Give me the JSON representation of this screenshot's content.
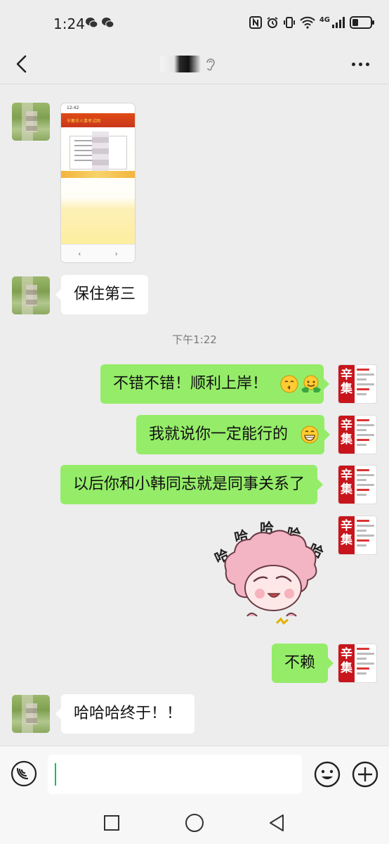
{
  "status_bar": {
    "time": "1:24",
    "network": "4G"
  },
  "nav": {
    "contact_name": ""
  },
  "timestamp": "下午1:22",
  "messages": {
    "left_1": "保住第三",
    "right_1": "不错不错！顺利上岸！",
    "right_2": "我就说你一定能行的",
    "right_3": "以后你和小韩同志就是同事关系了",
    "sticker_text": "哈哈哈哈哈",
    "right_4": "不赖",
    "left_2": "哈哈哈终于！！"
  },
  "avatar_right": {
    "poster_text": "辛集"
  },
  "shared_screenshot": {
    "header_text": "辛集市人事考试网"
  },
  "input": {
    "value": "",
    "placeholder": ""
  },
  "icons": [
    "back-icon",
    "more-icon",
    "voice-icon",
    "emoji-icon",
    "plus-icon",
    "square-nav-icon",
    "circle-nav-icon",
    "triangle-back-nav-icon"
  ],
  "colors": {
    "sent_bubble": "#95ec69",
    "received_bubble": "#ffffff",
    "background": "#ededed",
    "accent": "#07c160"
  }
}
